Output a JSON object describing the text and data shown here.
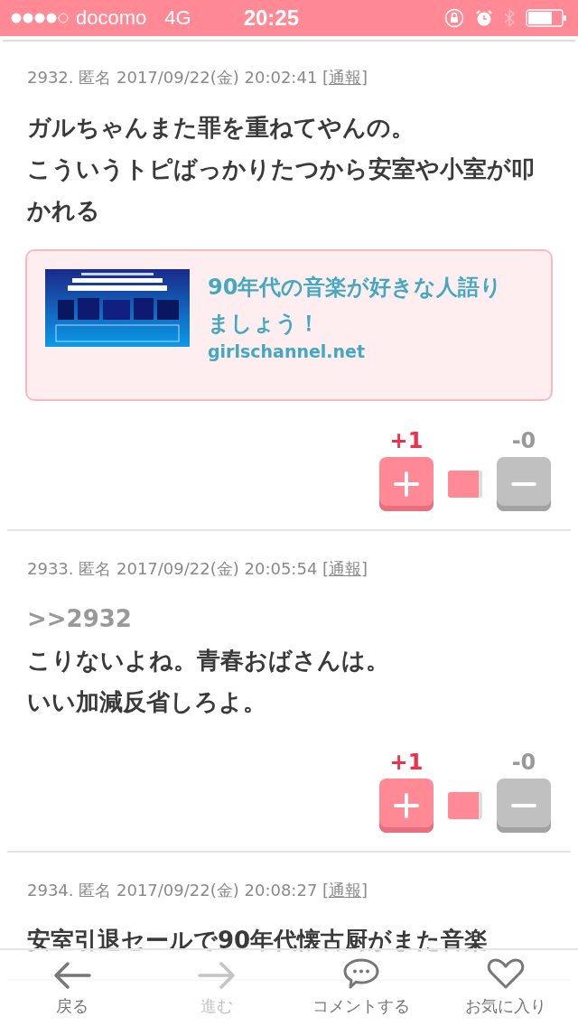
{
  "status_bar": {
    "carrier": "docomo",
    "network": "4G",
    "time": "20:25"
  },
  "comments": [
    {
      "number": "2932.",
      "name": "匿名",
      "date": "2017/09/22(金) 20:02:41",
      "report": "[通報]",
      "lines": [
        "ガルちゃんまた罪を重ねてやんの。",
        "こういうトピばっかりたつから安室や小室が叩かれる"
      ],
      "link_card": {
        "kind": "picture",
        "title": "90年代の音楽が好きな人語りましょう！",
        "domain": "girlschannel.net"
      },
      "plus": "+1",
      "minus": "-0"
    },
    {
      "number": "2933.",
      "name": "匿名",
      "date": "2017/09/22(金) 20:05:54",
      "report": "[通報]",
      "anchor": ">>2932",
      "lines": [
        "こりないよね。青春おばさんは。",
        "いい加減反省しろよ。"
      ],
      "plus": "+1",
      "minus": "-0"
    },
    {
      "number": "2934.",
      "name": "匿名",
      "date": "2017/09/22(金) 20:08:27",
      "report": "[通報]",
      "lines": [
        "安室引退セールで90年代懐古厨がまた音楽"
      ]
    }
  ],
  "toolbar": [
    {
      "kind": "back",
      "label": "戻る",
      "disabled": false
    },
    {
      "kind": "forward",
      "label": "進む",
      "disabled": true
    },
    {
      "kind": "comment",
      "label": "コメントする",
      "disabled": false
    },
    {
      "kind": "favorite",
      "label": "お気に入り",
      "disabled": false
    }
  ]
}
